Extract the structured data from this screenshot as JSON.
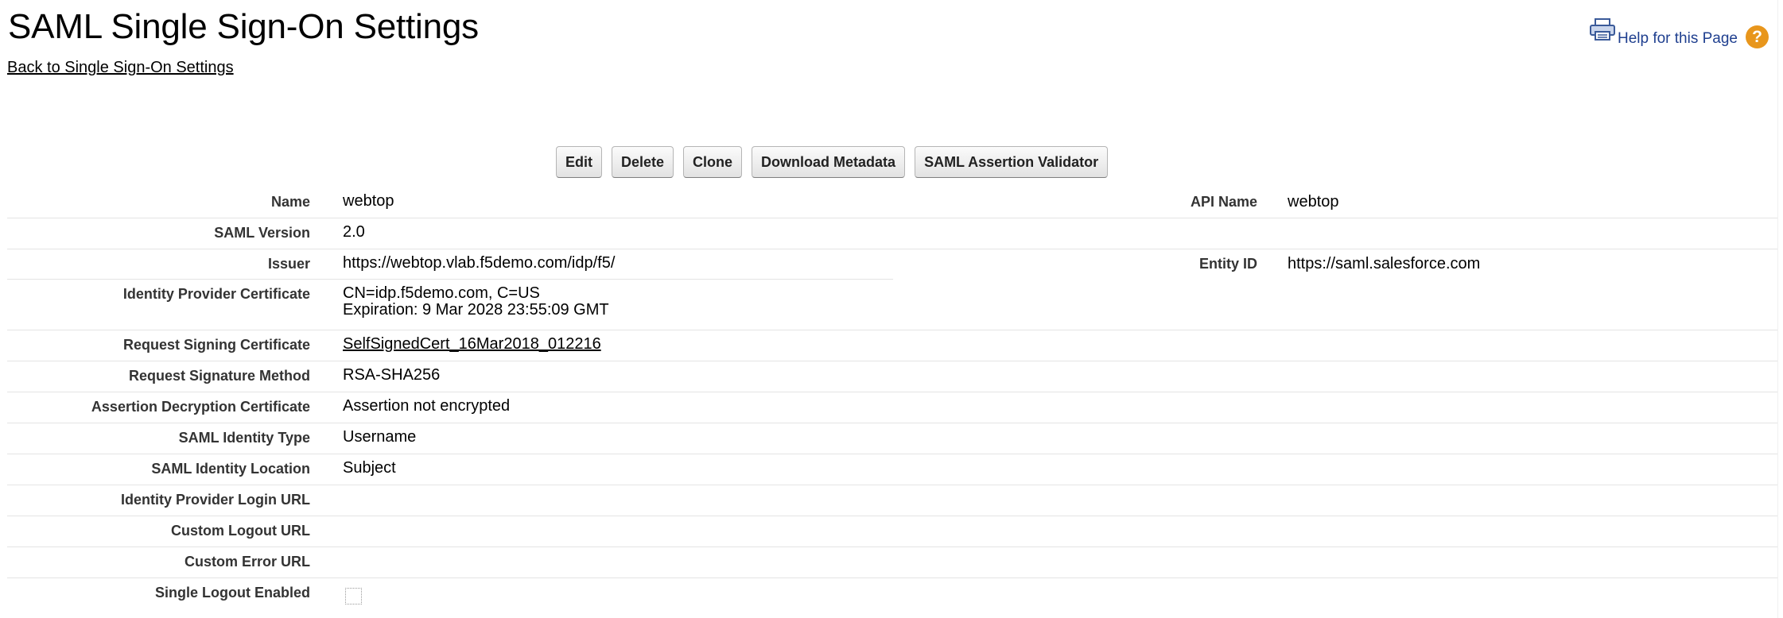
{
  "page": {
    "title": "SAML Single Sign-On Settings",
    "back_link": "Back to Single Sign-On Settings",
    "help_link": "Help for this Page",
    "help_icon_glyph": "?"
  },
  "icons": {
    "printer": "printer-icon",
    "help": "help-icon"
  },
  "colors": {
    "help_link": "#1f3f8f",
    "help_icon_bg": "#e8961c",
    "row_divider": "#e4e4e4",
    "label_text": "#333333"
  },
  "buttons": {
    "edit": "Edit",
    "delete": "Delete",
    "clone": "Clone",
    "download_metadata": "Download Metadata",
    "saml_assertion_validator": "SAML Assertion Validator"
  },
  "fields": {
    "name": {
      "label": "Name",
      "value": "webtop"
    },
    "api_name": {
      "label": "API Name",
      "value": "webtop"
    },
    "saml_version": {
      "label": "SAML Version",
      "value": "2.0"
    },
    "issuer": {
      "label": "Issuer",
      "value": "https://webtop.vlab.f5demo.com/idp/f5/"
    },
    "entity_id": {
      "label": "Entity ID",
      "value": "https://saml.salesforce.com"
    },
    "idp_certificate": {
      "label": "Identity Provider Certificate",
      "line1": "CN=idp.f5demo.com, C=US",
      "line2": "Expiration: 9 Mar 2028 23:55:09 GMT"
    },
    "request_signing_certificate": {
      "label": "Request Signing Certificate",
      "value": "SelfSignedCert_16Mar2018_012216"
    },
    "request_signature_method": {
      "label": "Request Signature Method",
      "value": "RSA-SHA256"
    },
    "assertion_decryption_certificate": {
      "label": "Assertion Decryption Certificate",
      "value": "Assertion not encrypted"
    },
    "saml_identity_type": {
      "label": "SAML Identity Type",
      "value": "Username"
    },
    "saml_identity_location": {
      "label": "SAML Identity Location",
      "value": "Subject"
    },
    "idp_login_url": {
      "label": "Identity Provider Login URL",
      "value": ""
    },
    "custom_logout_url": {
      "label": "Custom Logout URL",
      "value": ""
    },
    "custom_error_url": {
      "label": "Custom Error URL",
      "value": ""
    },
    "single_logout_enabled": {
      "label": "Single Logout Enabled",
      "checked": false
    }
  }
}
